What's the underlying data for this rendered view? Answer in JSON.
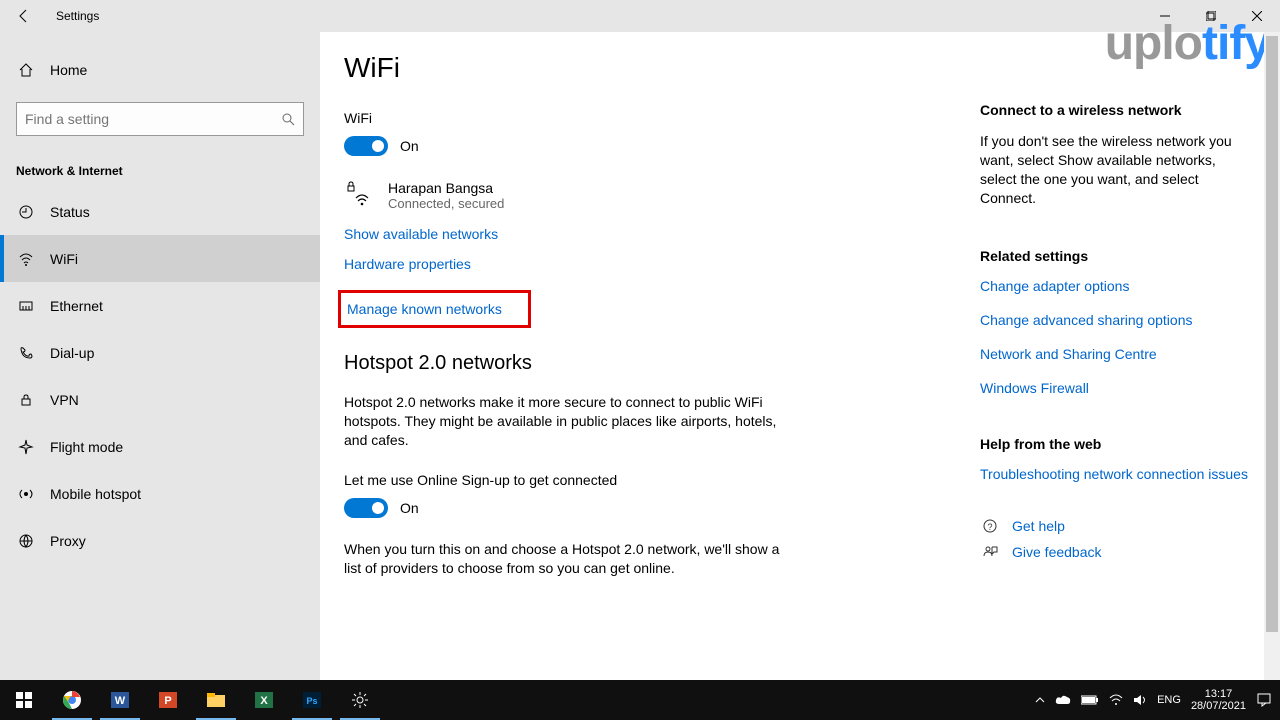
{
  "titlebar": {
    "title": "Settings"
  },
  "sidebar": {
    "home": "Home",
    "search_placeholder": "Find a setting",
    "category": "Network & Internet",
    "items": [
      {
        "label": "Status"
      },
      {
        "label": "WiFi"
      },
      {
        "label": "Ethernet"
      },
      {
        "label": "Dial-up"
      },
      {
        "label": "VPN"
      },
      {
        "label": "Flight mode"
      },
      {
        "label": "Mobile hotspot"
      },
      {
        "label": "Proxy"
      }
    ]
  },
  "main": {
    "title": "WiFi",
    "wifi_label": "WiFi",
    "wifi_state": "On",
    "network_name": "Harapan Bangsa",
    "network_status": "Connected, secured",
    "link_show": "Show available networks",
    "link_hw": "Hardware properties",
    "link_manage": "Manage known networks",
    "hotspot_title": "Hotspot 2.0 networks",
    "hotspot_desc": "Hotspot 2.0 networks make it more secure to connect to public WiFi hotspots. They might be available in public places like airports, hotels, and cafes.",
    "online_signup_label": "Let me use Online Sign-up to get connected",
    "online_signup_state": "On",
    "online_signup_desc": "When you turn this on and choose a Hotspot 2.0 network, we'll show a list of providers to choose from so you can get online."
  },
  "right": {
    "connect_head": "Connect to a wireless network",
    "connect_desc": "If you don't see the wireless network you want, select Show available networks, select the one you want, and select Connect.",
    "related_head": "Related settings",
    "link_adapter": "Change adapter options",
    "link_sharing": "Change advanced sharing options",
    "link_center": "Network and Sharing Centre",
    "link_firewall": "Windows Firewall",
    "help_head": "Help from the web",
    "link_trouble": "Troubleshooting network connection issues",
    "link_gethelp": "Get help",
    "link_feedback": "Give feedback"
  },
  "watermark": {
    "a": "uplo",
    "b": "tify"
  },
  "taskbar": {
    "lang": "ENG",
    "time": "13:17",
    "date": "28/07/2021"
  }
}
